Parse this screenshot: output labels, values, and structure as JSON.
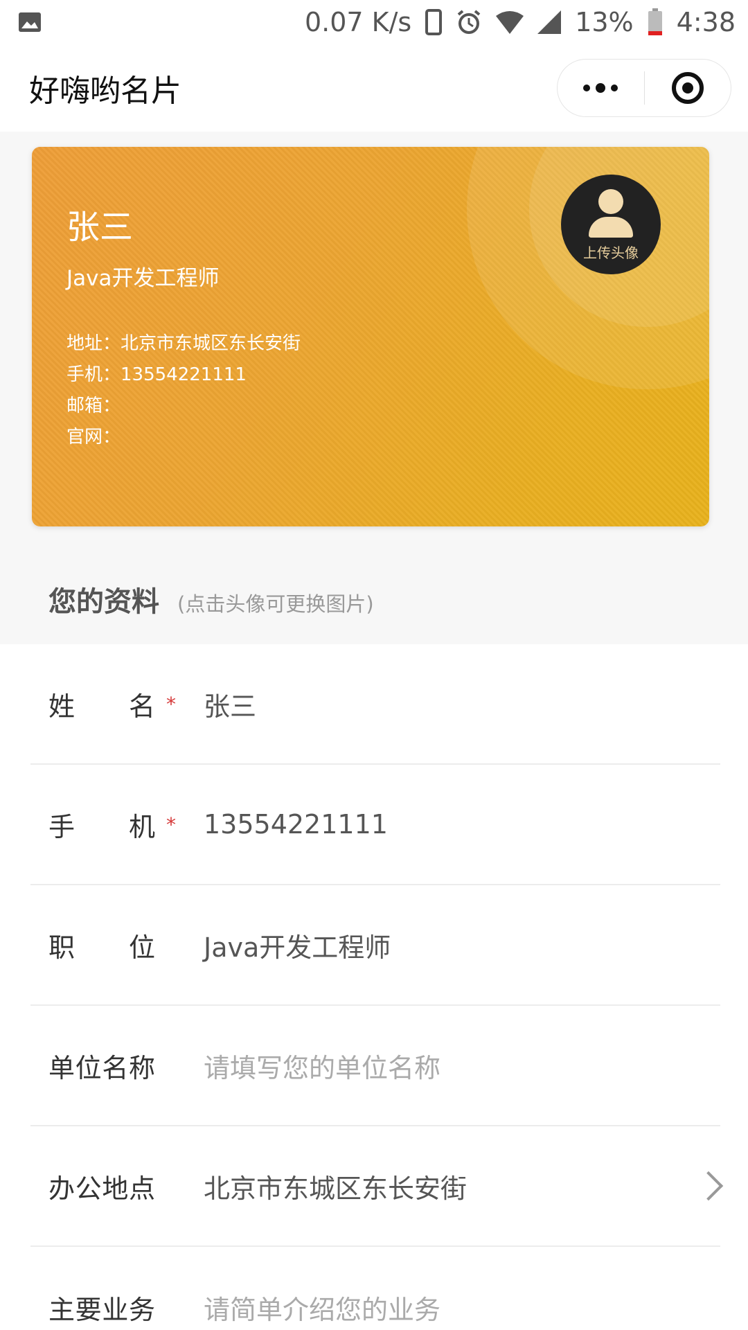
{
  "status": {
    "speed": "0.07 K/s",
    "battery": "13%",
    "time": "4:38"
  },
  "nav": {
    "title": "好嗨哟名片"
  },
  "card": {
    "name": "张三",
    "title": "Java开发工程师",
    "address": "地址：北京市东城区东长安街",
    "phone": "手机：13554221111",
    "email": "邮箱：",
    "website": "官网：",
    "avatar_label": "上传头像"
  },
  "section": {
    "title": "您的资料",
    "hint": "(点击头像可更换图片)"
  },
  "form": [
    {
      "label": "姓名",
      "value": "张三",
      "required": true
    },
    {
      "label": "手机",
      "value": "13554221111",
      "required": true
    },
    {
      "label": "职位",
      "value": "Java开发工程师",
      "required": false
    },
    {
      "label": "单位名称",
      "placeholder": "请填写您的单位名称",
      "required": false
    },
    {
      "label": "办公地点",
      "value": "北京市东城区东长安街",
      "required": false,
      "has_arrow": true
    },
    {
      "label": "主要业务",
      "placeholder": "请简单介绍您的业务",
      "required": false
    }
  ],
  "required_mark": "*"
}
